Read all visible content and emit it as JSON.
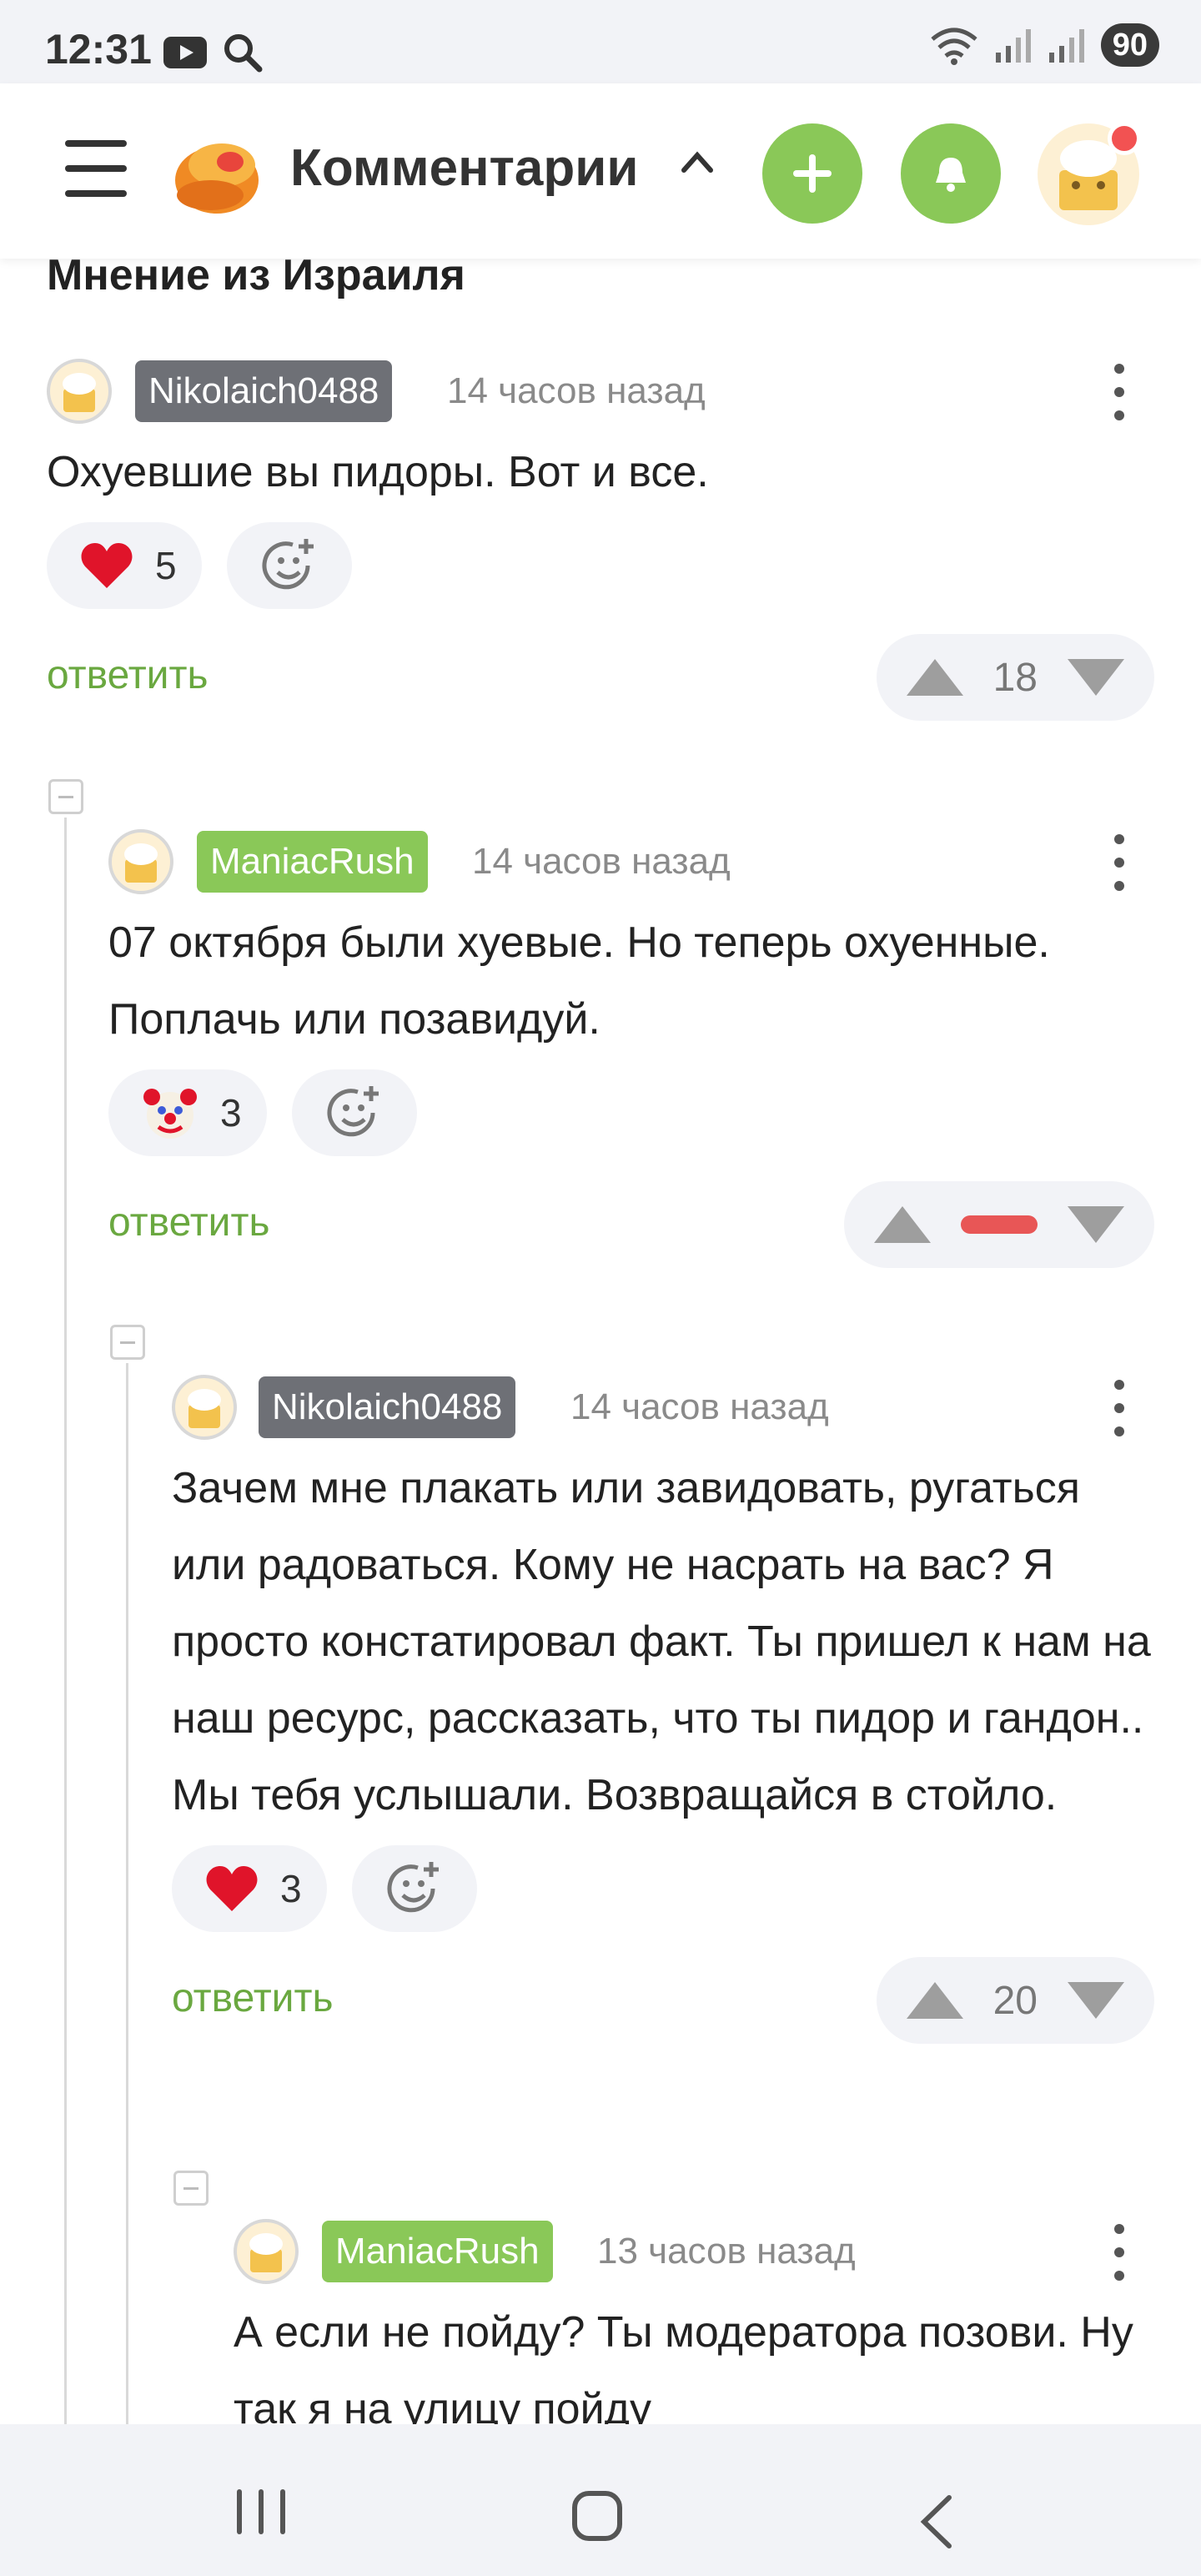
{
  "status_bar": {
    "time": "12:31",
    "wifi_label": "5",
    "battery": "90"
  },
  "header": {
    "title": "Комментарии"
  },
  "section": {
    "title": "Мнение из Израиля"
  },
  "comments": [
    {
      "author": "Nikolaich0488",
      "author_badge": "gray",
      "time": "14 часов назад",
      "text": "Охуевшие вы пидоры. Вот и все.",
      "reaction_emoji": "heart",
      "reaction_count": "5",
      "reply_label": "ответить",
      "rating": "18"
    },
    {
      "author": "ManiacRush",
      "author_badge": "green",
      "time": "14 часов назад",
      "text": "07 октября были хуевые. Но теперь охуенные. Поплачь или позавидуй.",
      "reaction_emoji": "clown",
      "reaction_count": "3",
      "reply_label": "ответить",
      "rating": "hidden-negative"
    },
    {
      "author": "Nikolaich0488",
      "author_badge": "gray",
      "time": "14 часов назад",
      "text": "Зачем мне плакать или завидовать, ругаться или радоваться. Кому не насрать на вас? Я просто констатировал факт. Ты пришел к нам на наш ресурс, рассказать, что ты пидор и гандон.. Мы тебя услышали. Возвращайся в стойло.",
      "reaction_emoji": "heart",
      "reaction_count": "3",
      "reply_label": "ответить",
      "rating": "20"
    },
    {
      "author": "ManiacRush",
      "author_badge": "green",
      "time": "13 часов назад",
      "text": "А если не пойду? Ты модератора позови. Ну так я на улицу пойду"
    }
  ]
}
